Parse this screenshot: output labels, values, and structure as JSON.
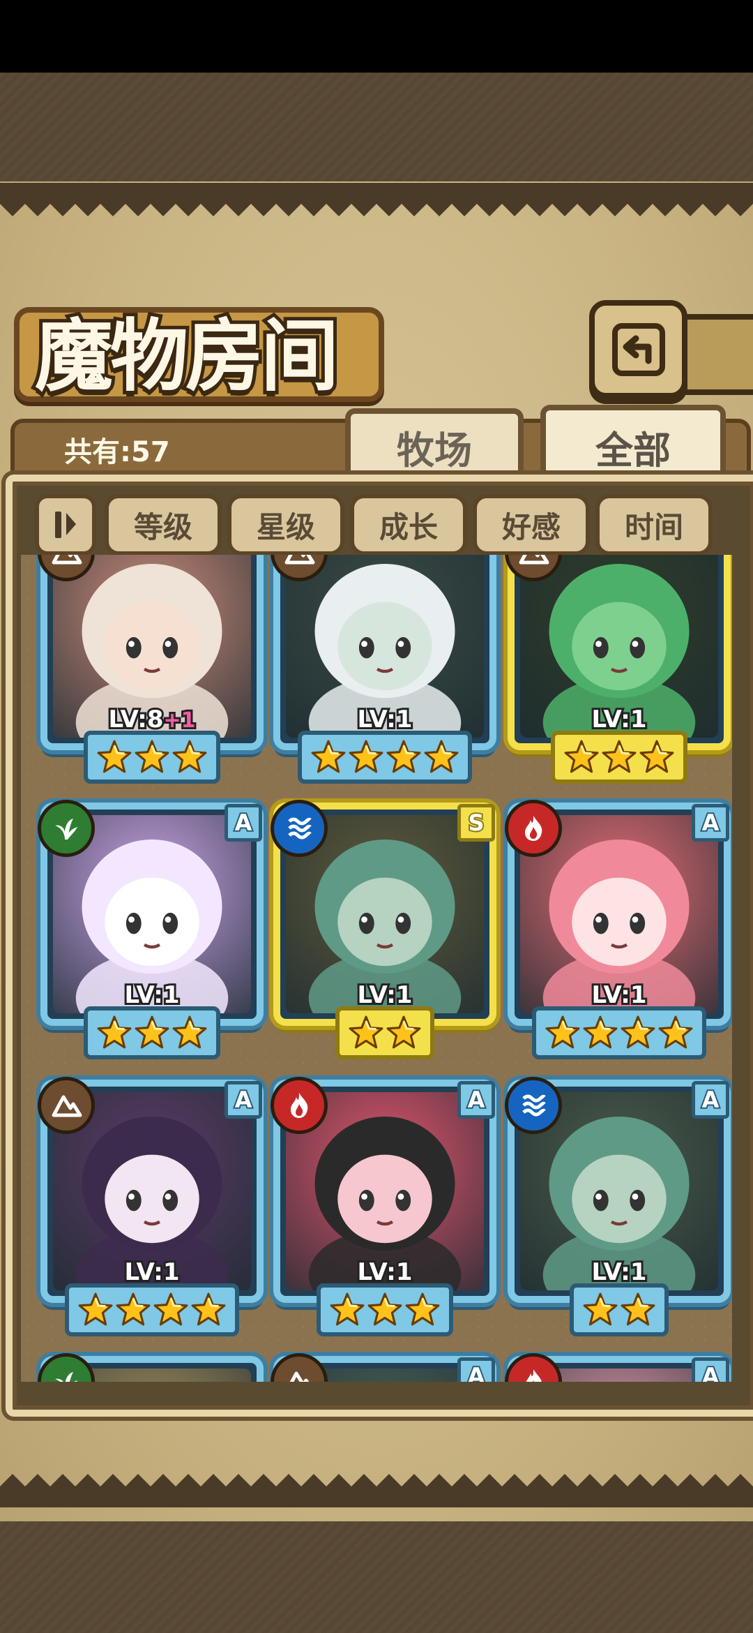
{
  "header": {
    "title": "魔物房间",
    "count_label": "共有:57"
  },
  "tabs": [
    {
      "label": "牧场",
      "active": false
    },
    {
      "label": "全部",
      "active": true
    }
  ],
  "filters": [
    "等级",
    "星级",
    "成长",
    "好感",
    "时间"
  ],
  "colors": {
    "frame_blue": "#7fc8e6",
    "frame_gold": "#f4e04a",
    "nature": "#2e7d32",
    "water": "#1565c0",
    "fire": "#c62828",
    "earth": "#6d4c2f"
  },
  "monsters": [
    {
      "level": "LV:8",
      "bonus": "+1",
      "stars": 3,
      "frame": "blue",
      "element": "earth-icon",
      "rank": "",
      "hair": "#efe2d6",
      "skin": "#f6e0d2",
      "bg": "#c98a7a"
    },
    {
      "level": "LV:1",
      "bonus": "",
      "stars": 4,
      "frame": "blue",
      "element": "earth-icon",
      "rank": "",
      "hair": "#e9eef0",
      "skin": "#d7e6dd",
      "bg": "#3b4b45"
    },
    {
      "level": "LV:1",
      "bonus": "",
      "stars": 3,
      "frame": "gold",
      "element": "earth-icon",
      "rank": "",
      "hair": "#4db06a",
      "skin": "#7ed08e",
      "bg": "#2f3d2a"
    },
    {
      "level": "LV:1",
      "bonus": "",
      "stars": 3,
      "frame": "blue",
      "element": "nature-icon",
      "rank": "A",
      "hair": "#f3e7ff",
      "skin": "#ffffff",
      "bg": "#c8a3e6"
    },
    {
      "level": "LV:1",
      "bonus": "",
      "stars": 2,
      "frame": "gold",
      "element": "water-icon",
      "rank": "S",
      "hair": "#5f9a86",
      "skin": "#b6d2c0",
      "bg": "#5e5a3a"
    },
    {
      "level": "LV:1",
      "bonus": "",
      "stars": 4,
      "frame": "blue",
      "element": "fire-icon",
      "rank": "A",
      "hair": "#f08a9a",
      "skin": "#fde3e3",
      "bg": "#e26b73"
    },
    {
      "level": "LV:1",
      "bonus": "",
      "stars": 4,
      "frame": "blue",
      "element": "earth-icon",
      "rank": "A",
      "hair": "#3d2b4e",
      "skin": "#f2e6f2",
      "bg": "#5b3b66"
    },
    {
      "level": "LV:1",
      "bonus": "",
      "stars": 3,
      "frame": "blue",
      "element": "fire-icon",
      "rank": "A",
      "hair": "#2a2a2a",
      "skin": "#f6c7cf",
      "bg": "#e0546c"
    },
    {
      "level": "LV:1",
      "bonus": "",
      "stars": 2,
      "frame": "blue",
      "element": "water-icon",
      "rank": "A",
      "hair": "#5f9a86",
      "skin": "#b6d2c0",
      "bg": "#4a5a48"
    },
    {
      "level": "",
      "bonus": "",
      "stars": 0,
      "frame": "blue",
      "element": "nature-icon",
      "rank": "",
      "hair": "#e9d6a8",
      "skin": "#f5e2c8",
      "bg": "#a38e5d"
    },
    {
      "level": "",
      "bonus": "",
      "stars": 0,
      "frame": "blue",
      "element": "earth-icon",
      "rank": "A",
      "hair": "#4a6a5a",
      "skin": "#c9d9c9",
      "bg": "#496058"
    },
    {
      "level": "",
      "bonus": "",
      "stars": 0,
      "frame": "blue",
      "element": "fire-icon",
      "rank": "A",
      "hair": "#f0b8c8",
      "skin": "#fbe2e8",
      "bg": "#d993a4"
    }
  ]
}
